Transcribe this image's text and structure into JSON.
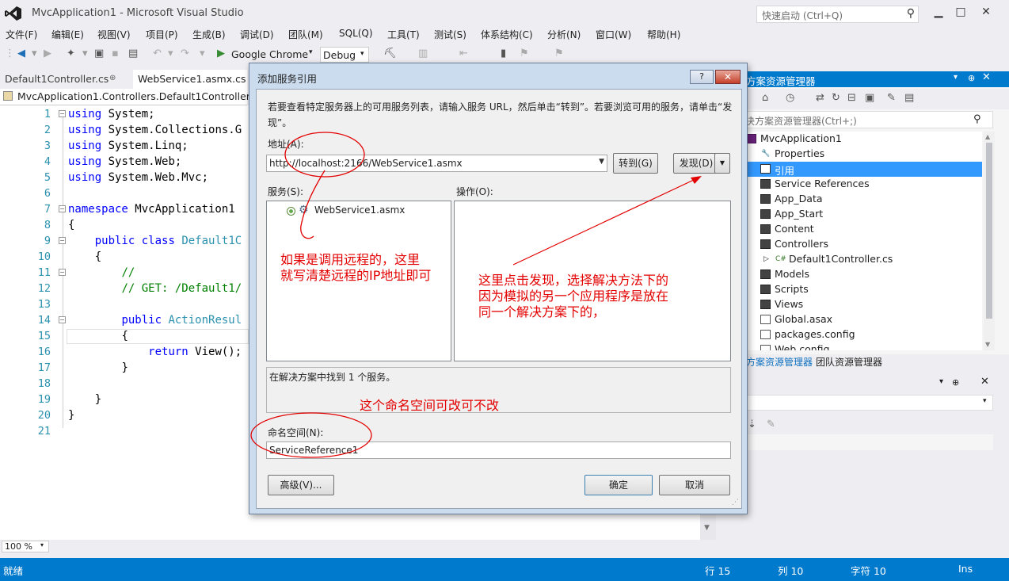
{
  "window": {
    "title": "MvcApplication1 - Microsoft Visual Studio",
    "quick_launch_placeholder": "快速启动 (Ctrl+Q)",
    "minimize": "▁",
    "maximize": "□",
    "close": "✕"
  },
  "menu": [
    "文件(F)",
    "编辑(E)",
    "视图(V)",
    "项目(P)",
    "生成(B)",
    "调试(D)",
    "团队(M)",
    "SQL(Q)",
    "工具(T)",
    "测试(S)",
    "体系结构(C)",
    "分析(N)",
    "窗口(W)",
    "帮助(H)"
  ],
  "toolbar": {
    "run_target": "Google Chrome",
    "config": "Debug"
  },
  "editor": {
    "tabs": [
      "Default1Controller.cs",
      "WebService1.asmx.cs"
    ],
    "tab_pin": "⊕",
    "navigation": "MvcApplication1.Controllers.Default1Controller",
    "line_numbers": [
      "1",
      "2",
      "3",
      "4",
      "5",
      "6",
      "7",
      "8",
      "9",
      "10",
      "11",
      "12",
      "13",
      "14",
      "15",
      "16",
      "17",
      "18",
      "19",
      "20",
      "21"
    ],
    "code": {
      "l1": "System;",
      "l2": "System.Collections.G",
      "l3": "System.Linq;",
      "l4": "System.Web;",
      "l5": "System.Web.Mvc;",
      "kw_using": "using",
      "kw_namespace": "namespace",
      "ns_name": " MvcApplication1",
      "brace_open": "{",
      "brace_close": "}",
      "kw_public": "public",
      "kw_class": "class",
      "class_name": "Default1C",
      "comment1": "//",
      "comment2": "// GET: /Default1/",
      "action_type": "ActionResul",
      "kw_return": "return",
      "return_call": " View();"
    },
    "zoom": "100 %"
  },
  "solution_explorer": {
    "title": "方案资源管理器",
    "search_placeholder": "决方案资源管理器(Ctrl+;)",
    "items": [
      {
        "label": "MvcApplication1",
        "icon": "project-icon"
      },
      {
        "label": "Properties",
        "icon": "wrench-icon"
      },
      {
        "label": "引用",
        "icon": "references-icon"
      },
      {
        "label": "Service References",
        "icon": "folder-icon"
      },
      {
        "label": "App_Data",
        "icon": "folder-icon"
      },
      {
        "label": "App_Start",
        "icon": "folder-icon"
      },
      {
        "label": "Content",
        "icon": "folder-icon"
      },
      {
        "label": "Controllers",
        "icon": "folder-icon"
      },
      {
        "label": "Default1Controller.cs",
        "icon": "csharp-file-icon"
      },
      {
        "label": "Models",
        "icon": "folder-icon"
      },
      {
        "label": "Scripts",
        "icon": "folder-icon"
      },
      {
        "label": "Views",
        "icon": "folder-icon"
      },
      {
        "label": "Global.asax",
        "icon": "global-file-icon"
      },
      {
        "label": "packages.config",
        "icon": "config-file-icon"
      },
      {
        "label": "Web.config",
        "icon": "config-file-icon"
      }
    ],
    "bottom_tabs": [
      "方案资源管理器",
      "团队资源管理器"
    ]
  },
  "statusbar": {
    "ready": "就绪",
    "line": "行 15",
    "column": "列 10",
    "char": "字符 10",
    "mode": "Ins"
  },
  "dialog": {
    "title": "添加服务引用",
    "help": "?",
    "close": "✕",
    "intro": "若要查看特定服务器上的可用服务列表，请输入服务 URL，然后单击“转到”。若要浏览可用的服务，请单击“发现”。",
    "address_label": "地址(A):",
    "address_value": "http://localhost:2166/WebService1.asmx",
    "goto_label": "转到(G)",
    "discover_label": "发现(D)",
    "services_label": "服务(S):",
    "operations_label": "操作(O):",
    "service_item": "WebService1.asmx",
    "status_message": "在解决方案中找到 1 个服务。",
    "namespace_label": "命名空间(N):",
    "namespace_value": "ServiceReference1",
    "advanced_label": "高级(V)...",
    "ok_label": "确定",
    "cancel_label": "取消"
  },
  "annotations": {
    "remote_line1": "如果是调用远程的，这里",
    "remote_line2": "就写清楚远程的IP地址即可",
    "discover_line1": "这里点击发现，选择解决方法下的",
    "discover_line2": "因为模拟的另一个应用程序是放在",
    "discover_line3": "同一个解决方案下的，",
    "namespace_note": "这个命名空间可改可不改"
  },
  "colors": {
    "accent": "#007acc",
    "annotation": "#e30000",
    "keyword": "#0000ff",
    "type": "#2b91af",
    "comment": "#008000"
  }
}
